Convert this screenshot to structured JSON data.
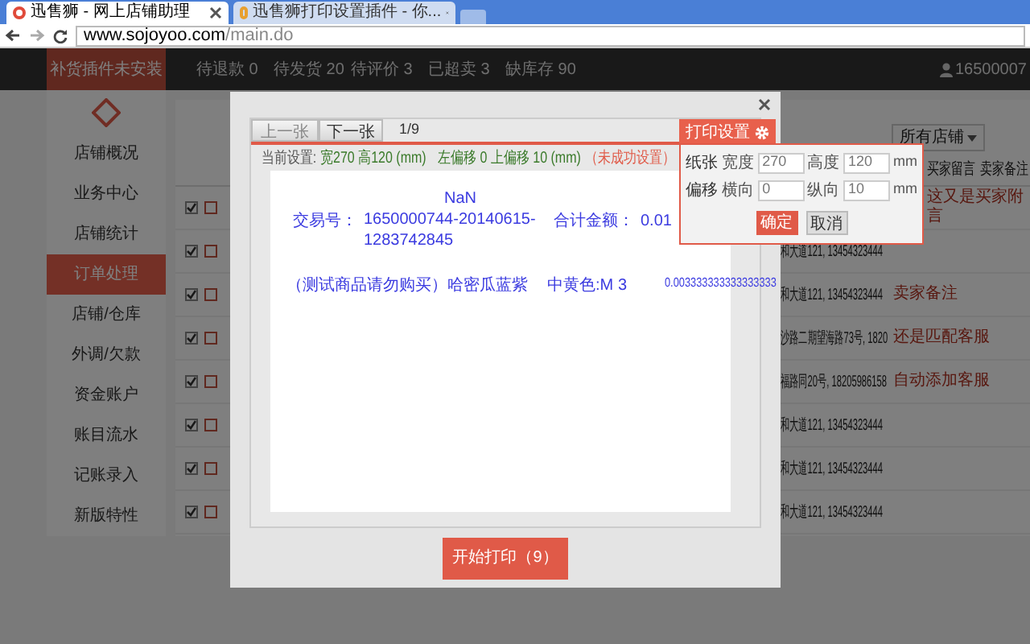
{
  "browser": {
    "tabs": [
      {
        "title": "迅售狮 - 网上店铺助理",
        "selected": true
      },
      {
        "title": "迅售狮打印设置插件 - 你...",
        "selected": false
      }
    ],
    "url_host": "www.sojoyoo.com",
    "url_path": "/main.do"
  },
  "background": {
    "top_button": "补货插件未安装",
    "stats": [
      "待退款 0",
      "待发货 20",
      "待评价 3",
      "已超卖 3",
      "缺库存 90"
    ],
    "user": "16500007",
    "sidebar": [
      {
        "label": "店铺概况",
        "selected": false
      },
      {
        "label": "业务中心",
        "selected": false
      },
      {
        "label": "店铺统计",
        "selected": false
      },
      {
        "label": "订单处理",
        "selected": true
      },
      {
        "label": "店铺/仓库",
        "selected": false
      },
      {
        "label": "外调/欠款",
        "selected": false
      },
      {
        "label": "资金账户",
        "selected": false
      },
      {
        "label": "账目流水",
        "selected": false
      },
      {
        "label": "记账录入",
        "selected": false
      },
      {
        "label": "新版特性",
        "selected": false
      }
    ],
    "filter": "所有店铺",
    "columns": [
      "买家留言",
      "卖家备注"
    ],
    "rows": [
      {
        "checked": true,
        "address": "",
        "note": "这又是买家附言"
      },
      {
        "checked": true,
        "address": "和大道121, 13454323444",
        "note": ""
      },
      {
        "checked": true,
        "address": "和大道121, 13454323444",
        "note": "卖家备注"
      },
      {
        "checked": true,
        "address": "沙路二期望海路73号, 1820",
        "note": "还是匹配客服"
      },
      {
        "checked": true,
        "address": "福路同20号, 18205986158",
        "note": "自动添加客服"
      },
      {
        "checked": true,
        "address": "和大道121, 13454323444",
        "note": ""
      },
      {
        "checked": true,
        "address": "和大道121, 13454323444",
        "note": ""
      },
      {
        "checked": true,
        "address": "和大道121, 13454323444",
        "note": ""
      }
    ]
  },
  "dialog": {
    "prev": "上一张",
    "next": "下一张",
    "page": "1/9",
    "info": {
      "label": "当前设置:",
      "size": "宽270 高120 (mm)",
      "offset": "左偏移 0 上偏移 10 (mm)",
      "status": "（未成功设置）"
    },
    "paper": {
      "title": "NaN",
      "trade_label": "交易号：",
      "trade_no": [
        "1650000744-20140615-",
        "1283742845"
      ],
      "total_label": "合计金额：",
      "total": "0.01",
      "item": [
        "（测试商品请勿购买）哈密瓜蓝紫",
        "中黄色:M",
        "3",
        "0.003333333333333333"
      ]
    },
    "print_button": "开始打印（9）"
  },
  "settings": {
    "button": "打印设置",
    "rows": [
      {
        "label": "纸张",
        "fields": [
          {
            "label": "宽度",
            "value": "270"
          },
          {
            "label": "高度",
            "value": "120",
            "unit": "mm"
          }
        ]
      },
      {
        "label": "偏移",
        "fields": [
          {
            "label": "横向",
            "value": "0"
          },
          {
            "label": "纵向",
            "value": "10",
            "unit": "mm"
          }
        ]
      }
    ],
    "ok": "确定",
    "cancel": "取消"
  }
}
